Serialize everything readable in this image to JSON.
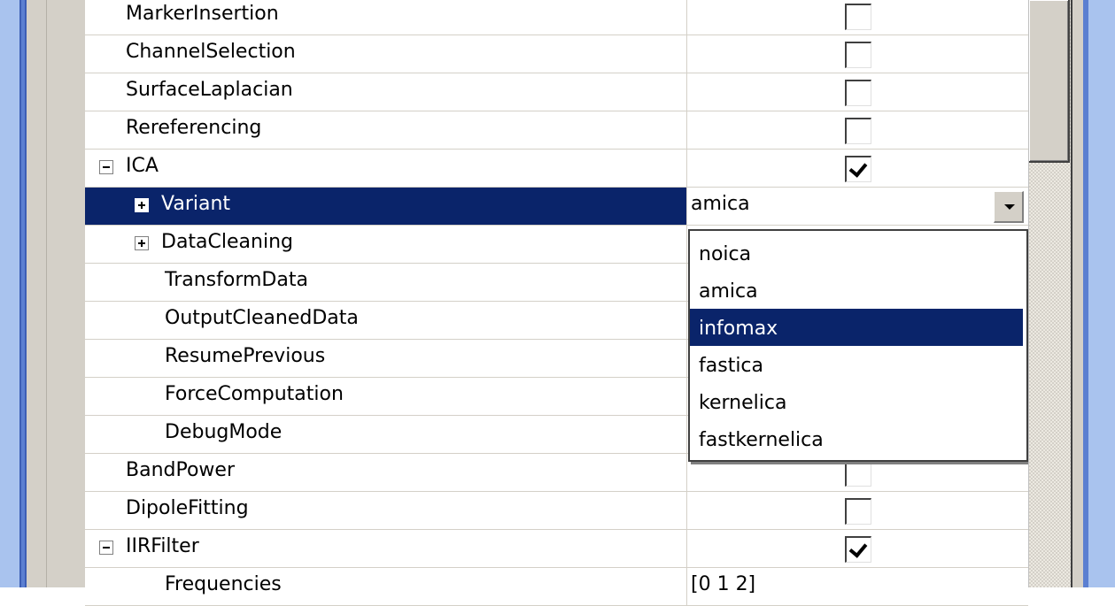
{
  "rows": [
    {
      "label": "MarkerInsertion",
      "value_type": "checkbox",
      "checked": false
    },
    {
      "label": "ChannelSelection",
      "value_type": "checkbox",
      "checked": false
    },
    {
      "label": "SurfaceLaplacian",
      "value_type": "checkbox",
      "checked": false
    },
    {
      "label": "Rereferencing",
      "value_type": "checkbox",
      "checked": false
    },
    {
      "label": "ICA",
      "value_type": "checkbox",
      "checked": true,
      "expander": "minus"
    },
    {
      "label": "Variant",
      "value": "amica",
      "value_type": "dropdown",
      "expander": "plus",
      "selected": true
    },
    {
      "label": "DataCleaning",
      "expander": "plus"
    },
    {
      "label": "TransformData"
    },
    {
      "label": "OutputCleanedData"
    },
    {
      "label": "ResumePrevious"
    },
    {
      "label": "ForceComputation"
    },
    {
      "label": "DebugMode"
    },
    {
      "label": "BandPower",
      "value_type": "checkbox",
      "checked": false
    },
    {
      "label": "DipoleFitting",
      "value_type": "checkbox",
      "checked": false
    },
    {
      "label": "IIRFilter",
      "value_type": "checkbox",
      "checked": true,
      "expander": "minus"
    },
    {
      "label": "Frequencies",
      "value": "[0 1 2]"
    }
  ],
  "dropdown": {
    "options": [
      "noica",
      "amica",
      "infomax",
      "fastica",
      "kernelica",
      "fastkernelica"
    ],
    "highlighted": "infomax"
  },
  "colors": {
    "selection": "#0a246a",
    "chrome_gray": "#d4d0c8",
    "window_blue": "#5b7fd1"
  }
}
